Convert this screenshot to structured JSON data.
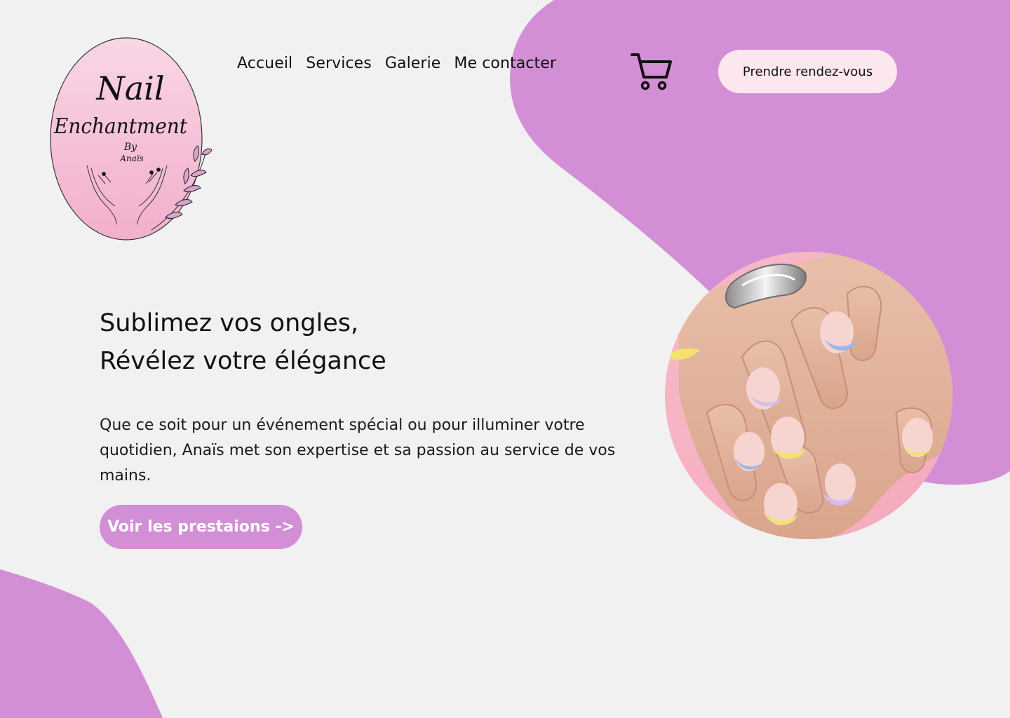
{
  "colors": {
    "background": "#f1f1f1",
    "blob": "#d38fd5",
    "cta_top_bg": "#fde7ef",
    "cta_main_bg": "#d38fd5",
    "text": "#111111",
    "logo_oval": "#f2b6d2"
  },
  "logo": {
    "line1": "Nail",
    "line2": "Enchantment",
    "line3": "By",
    "line4": "Anaïs"
  },
  "nav": {
    "items": [
      {
        "label": "Accueil"
      },
      {
        "label": "Services"
      },
      {
        "label": "Galerie"
      },
      {
        "label": "Me contacter"
      }
    ],
    "cart_icon": "shopping-cart-icon",
    "appointment_label": "Prendre rendez-vous"
  },
  "hero": {
    "title_line1": "Sublimez vos ongles,",
    "title_line2": "Révélez votre élégance",
    "paragraph": "Que ce soit pour un événement spécial ou pour illuminer votre quotidien, Anaïs met son expertise et sa passion au service de vos mains.",
    "cta_label": "Voir les prestaions ->"
  },
  "photo": {
    "subject": "manicured-hands-image"
  }
}
